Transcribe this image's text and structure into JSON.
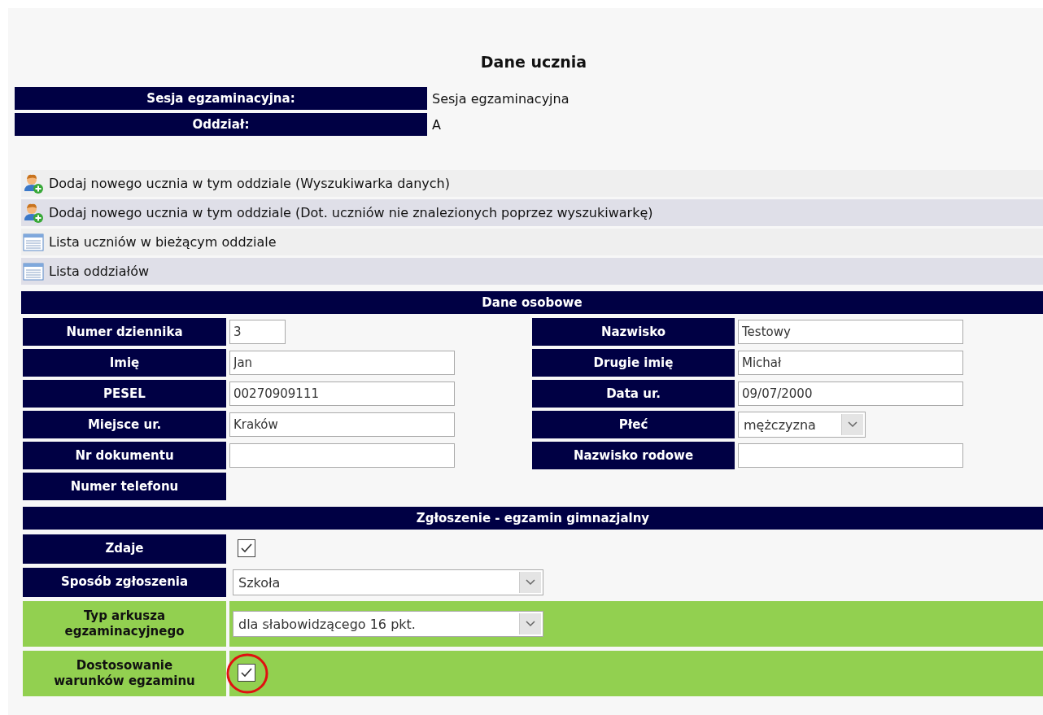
{
  "title": "Dane ucznia",
  "info": [
    {
      "label": "Sesja egzaminacyjna:",
      "value": "Sesja egzaminacyjna"
    },
    {
      "label": "Oddział:",
      "value": "A"
    }
  ],
  "links": [
    {
      "kind": "add",
      "label": "Dodaj nowego ucznia w tym oddziale (Wyszukiwarka danych)"
    },
    {
      "kind": "add",
      "label": "Dodaj nowego ucznia w tym oddziale (Dot. uczniów nie znalezionych poprzez wyszukiwarkę)"
    },
    {
      "kind": "list",
      "label": "Lista uczniów w bieżącym oddziale"
    },
    {
      "kind": "list",
      "label": "Lista oddziałów"
    }
  ],
  "personal": {
    "heading": "Dane osobowe",
    "rows": [
      {
        "left": {
          "label": "Numer dziennika",
          "kind": "short-input",
          "value": "3"
        },
        "right": {
          "label": "Nazwisko",
          "kind": "input",
          "value": "Testowy"
        }
      },
      {
        "left": {
          "label": "Imię",
          "kind": "input",
          "value": "Jan"
        },
        "right": {
          "label": "Drugie imię",
          "kind": "input",
          "value": "Michał"
        }
      },
      {
        "left": {
          "label": "PESEL",
          "kind": "input",
          "value": "00270909111"
        },
        "right": {
          "label": "Data ur.",
          "kind": "input",
          "value": "09/07/2000"
        }
      },
      {
        "left": {
          "label": "Miejsce ur.",
          "kind": "input",
          "value": "Kraków"
        },
        "right": {
          "label": "Płeć",
          "kind": "small-select",
          "value": "mężczyzna"
        }
      },
      {
        "left": {
          "label": "Nr dokumentu",
          "kind": "input"
        },
        "right": {
          "label": "Nazwisko rodowe",
          "kind": "input"
        }
      },
      {
        "left": {
          "label": "Numer telefonu",
          "kind": "none"
        }
      }
    ]
  },
  "exam": {
    "heading": "Zgłoszenie - egzamin gimnazjalny",
    "rows": [
      {
        "label": "Zdaje",
        "kind": "checkbox",
        "checked": true,
        "highlighted": false,
        "circled": false
      },
      {
        "label": "Sposób zgłoszenia",
        "kind": "select",
        "value": "Szkoła",
        "highlighted": false
      },
      {
        "label": "Typ arkusza egzaminacyjnego",
        "kind": "select",
        "value": "dla słabowidzącego 16 pkt.",
        "highlighted": true
      },
      {
        "label": "Dostosowanie warunków egzaminu",
        "kind": "checkbox",
        "checked": true,
        "highlighted": true,
        "circled": true
      }
    ]
  }
}
